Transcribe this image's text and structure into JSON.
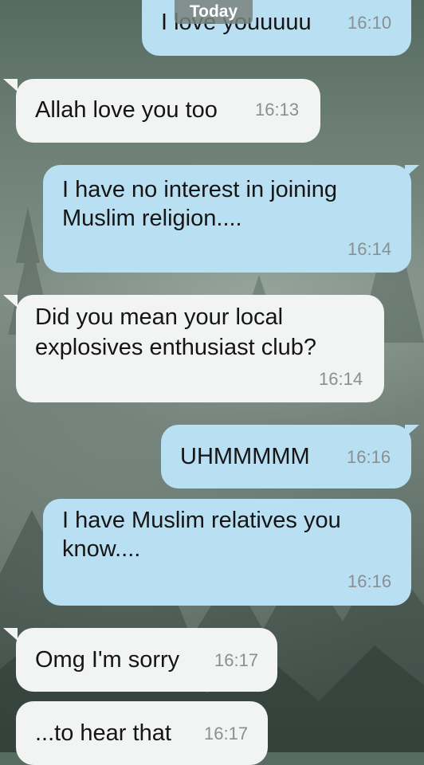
{
  "date_divider": "Today",
  "messages": [
    {
      "direction": "out",
      "text": "I love youuuuu",
      "time": "16:10"
    },
    {
      "direction": "in",
      "text": "Allah love you too",
      "time": "16:13"
    },
    {
      "direction": "out",
      "lines": [
        "I have no interest in joining",
        "Muslim religion...."
      ],
      "time": "16:14"
    },
    {
      "direction": "in",
      "lines": [
        "Did you mean your local",
        "explosives enthusiast club?"
      ],
      "time": "16:14"
    },
    {
      "direction": "out",
      "text": "UHMMMMM",
      "time": "16:16"
    },
    {
      "direction": "out",
      "lines": [
        "I have Muslim relatives you",
        "know...."
      ],
      "time": "16:16"
    },
    {
      "direction": "in",
      "text": "Omg I'm sorry",
      "time": "16:17"
    },
    {
      "direction": "in",
      "text": "...to hear that",
      "time": "16:17"
    }
  ],
  "colors": {
    "outgoing_bubble": "#b9dff2",
    "incoming_bubble": "#f2f3f3",
    "timestamp": "#8a8f92"
  }
}
